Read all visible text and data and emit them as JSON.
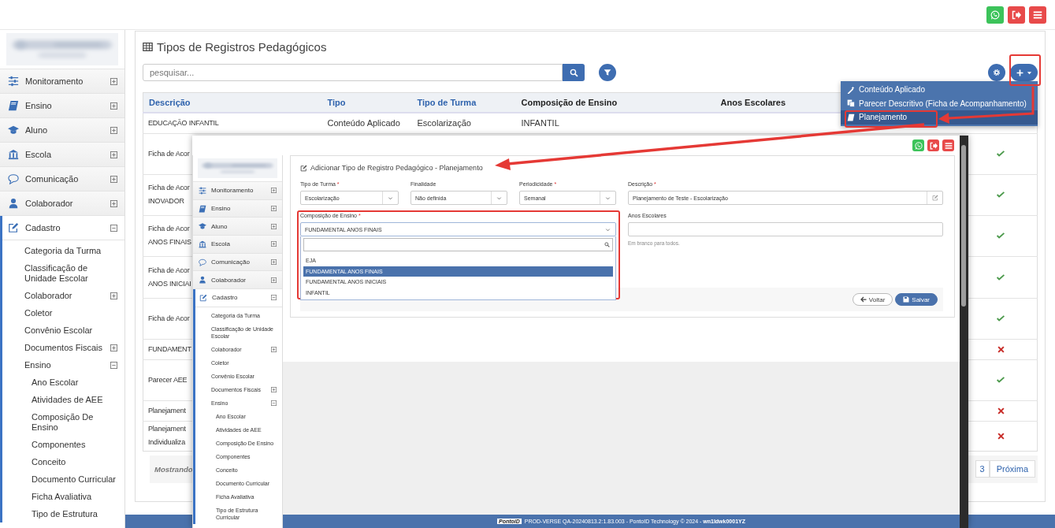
{
  "header": {
    "buttons": [
      {
        "kind": "whatsapp"
      },
      {
        "kind": "logout"
      },
      {
        "kind": "menu"
      }
    ]
  },
  "sidebar": {
    "items": [
      {
        "label": "Monitoramento",
        "expanded": false
      },
      {
        "label": "Ensino",
        "expanded": false
      },
      {
        "label": "Aluno",
        "expanded": false
      },
      {
        "label": "Escola",
        "expanded": false
      },
      {
        "label": "Comunicação",
        "expanded": false
      },
      {
        "label": "Colaborador",
        "expanded": false
      },
      {
        "label": "Cadastro",
        "expanded": true,
        "children": [
          {
            "label": "Categoria da Turma"
          },
          {
            "label": "Classificação de Unidade Escolar"
          },
          {
            "label": "Colaborador",
            "expanded": false
          },
          {
            "label": "Coletor"
          },
          {
            "label": "Convênio Escolar"
          },
          {
            "label": "Documentos Fiscais",
            "expanded": false
          },
          {
            "label": "Ensino",
            "expanded": true,
            "children": [
              {
                "label": "Ano Escolar"
              },
              {
                "label": "Atividades de AEE"
              },
              {
                "label": "Composição De Ensino"
              },
              {
                "label": "Componentes"
              },
              {
                "label": "Conceito"
              },
              {
                "label": "Documento Curricular"
              },
              {
                "label": "Ficha Avaliativa"
              },
              {
                "label": "Tipo de Estrutura"
              }
            ]
          }
        ]
      }
    ]
  },
  "page": {
    "title": "Tipos de Registros Pedagógicos",
    "search": {
      "placeholder": "pesquisar..."
    }
  },
  "table": {
    "columns": [
      {
        "label": "Descrição",
        "sortable": true
      },
      {
        "label": "Tipo",
        "sortable": true
      },
      {
        "label": "Tipo de Turma",
        "sortable": true
      },
      {
        "label": "Composição de Ensino",
        "sortable": false
      },
      {
        "label": "Anos Escolares",
        "sortable": false
      }
    ],
    "rows": [
      {
        "cells": [
          "EDUCAÇÃO INFANTIL",
          "Conteúdo Aplicado",
          "Escolarização",
          "INFANTIL"
        ]
      },
      {
        "cells": [
          "Ficha de Acor"
        ],
        "active": true
      },
      {
        "cells": [
          "Ficha de Acor\nINOVADOR"
        ],
        "active": true
      },
      {
        "cells": [
          "Ficha de Acor\nANOS FINAIS"
        ],
        "active": true
      },
      {
        "cells": [
          "Ficha de Acor\nANOS INICIAI"
        ],
        "active": true
      },
      {
        "cells": [
          "Ficha de Acor"
        ],
        "active": true
      },
      {
        "cells": [
          "FUNDAMENT"
        ],
        "active": false
      },
      {
        "cells": [
          "Parecer AEE"
        ],
        "active": true
      },
      {
        "cells": [
          "Planejament"
        ],
        "active": false
      },
      {
        "cells": [
          "Planejament\nIndividualiza"
        ],
        "active": false
      }
    ],
    "footer": {
      "summary": "Mostrando",
      "pages": [
        {
          "label": "3",
          "selected": false
        }
      ],
      "next": "Próxima"
    }
  },
  "add_menu": {
    "items": [
      {
        "label": "Conteúdo Aplicado",
        "selected": false
      },
      {
        "label": "Parecer Descritivo (Ficha de Acompanhamento)",
        "selected": false
      },
      {
        "label": "Planejamento",
        "selected": true
      }
    ]
  },
  "inner_window": {
    "header": {
      "buttons": [
        {
          "kind": "whatsapp"
        },
        {
          "kind": "logout"
        },
        {
          "kind": "menu"
        }
      ]
    },
    "sidebar": {
      "items": [
        {
          "label": "Monitoramento",
          "expanded": false
        },
        {
          "label": "Ensino",
          "expanded": false
        },
        {
          "label": "Aluno",
          "expanded": false
        },
        {
          "label": "Escola",
          "expanded": false
        },
        {
          "label": "Comunicação",
          "expanded": false
        },
        {
          "label": "Colaborador",
          "expanded": false
        },
        {
          "label": "Cadastro",
          "expanded": true,
          "children": [
            {
              "label": "Categoria da Turma"
            },
            {
              "label": "Classificação de Unidade Escolar"
            },
            {
              "label": "Colaborador",
              "expanded": false
            },
            {
              "label": "Coletor"
            },
            {
              "label": "Convênio Escolar"
            },
            {
              "label": "Documentos Fiscais",
              "expanded": false
            },
            {
              "label": "Ensino",
              "expanded": true,
              "children": [
                {
                  "label": "Ano Escolar"
                },
                {
                  "label": "Atividades de AEE"
                },
                {
                  "label": "Composição De Ensino"
                },
                {
                  "label": "Componentes"
                },
                {
                  "label": "Conceito"
                },
                {
                  "label": "Documento Curricular"
                },
                {
                  "label": "Ficha Avaliativa"
                },
                {
                  "label": "Tipo de Estrutura Curricular"
                }
              ]
            }
          ]
        }
      ]
    },
    "form": {
      "title": "Adicionar Tipo de Registro Pedagógico - Planejamento",
      "fields": [
        {
          "kind": "select",
          "label": "Tipo de Turma",
          "required_mark": "*",
          "value": "Escolarização"
        },
        {
          "kind": "select",
          "label": "Finalidade",
          "value": "Não definida"
        },
        {
          "kind": "select",
          "label": "Periodicidade",
          "required_mark": "*",
          "value": "Semanal"
        },
        {
          "kind": "text",
          "label": "Descrição",
          "required_mark": "*",
          "value": "Planejamento de Teste - Escolarização"
        }
      ],
      "composicao": {
        "label": "Composição de Ensino",
        "required_mark": "*",
        "value": "FUNDAMENTAL ANOS FINAIS",
        "options": [
          {
            "label": "EJA",
            "selected": false
          },
          {
            "label": "FUNDAMENTAL ANOS FINAIS",
            "selected": true
          },
          {
            "label": "FUNDAMENTAL ANOS INICIAIS",
            "selected": false
          },
          {
            "label": "INFANTIL",
            "selected": false
          }
        ]
      },
      "anos": {
        "label": "Anos Escolares",
        "help": "Em branco para todos."
      },
      "buttons": [
        {
          "kind": "back",
          "label": "Voltar"
        },
        {
          "kind": "save",
          "label": "Salvar"
        }
      ]
    },
    "footer": {
      "logo": "PontoiD",
      "text": "PROD-VERSE QA-20240813.2:1.83.003 - PontoID Technology © 2024 - **wn1ldwk0001YZ**"
    }
  }
}
